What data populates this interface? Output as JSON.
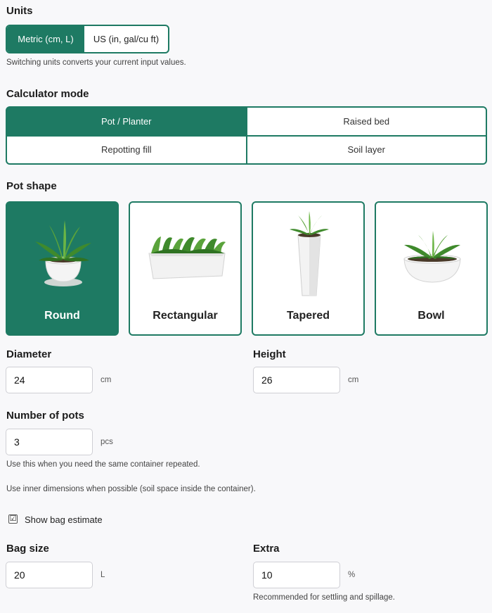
{
  "units": {
    "title": "Units",
    "options": [
      "Metric (cm, L)",
      "US (in, gal/cu ft)"
    ],
    "help": "Switching units converts your current input values."
  },
  "mode": {
    "title": "Calculator mode",
    "options": [
      "Pot / Planter",
      "Raised bed",
      "Repotting fill",
      "Soil layer"
    ]
  },
  "shape": {
    "title": "Pot shape",
    "cards": [
      "Round",
      "Rectangular",
      "Tapered",
      "Bowl"
    ]
  },
  "diameter": {
    "label": "Diameter",
    "value": "24",
    "unit": "cm"
  },
  "height": {
    "label": "Height",
    "value": "26",
    "unit": "cm"
  },
  "pots": {
    "label": "Number of pots",
    "value": "3",
    "unit": "pcs",
    "help": "Use this when you need the same container repeated."
  },
  "inner_note": "Use inner dimensions when possible (soil space inside the container).",
  "bag_toggle": {
    "label": "Show bag estimate",
    "checked": "☑"
  },
  "bag_size": {
    "label": "Bag size",
    "value": "20",
    "unit": "L"
  },
  "extra": {
    "label": "Extra",
    "value": "10",
    "unit": "%",
    "help": "Recommended for settling and spillage."
  },
  "colors": {
    "accent": "#1e7a63",
    "background": "#f8f8fa"
  }
}
